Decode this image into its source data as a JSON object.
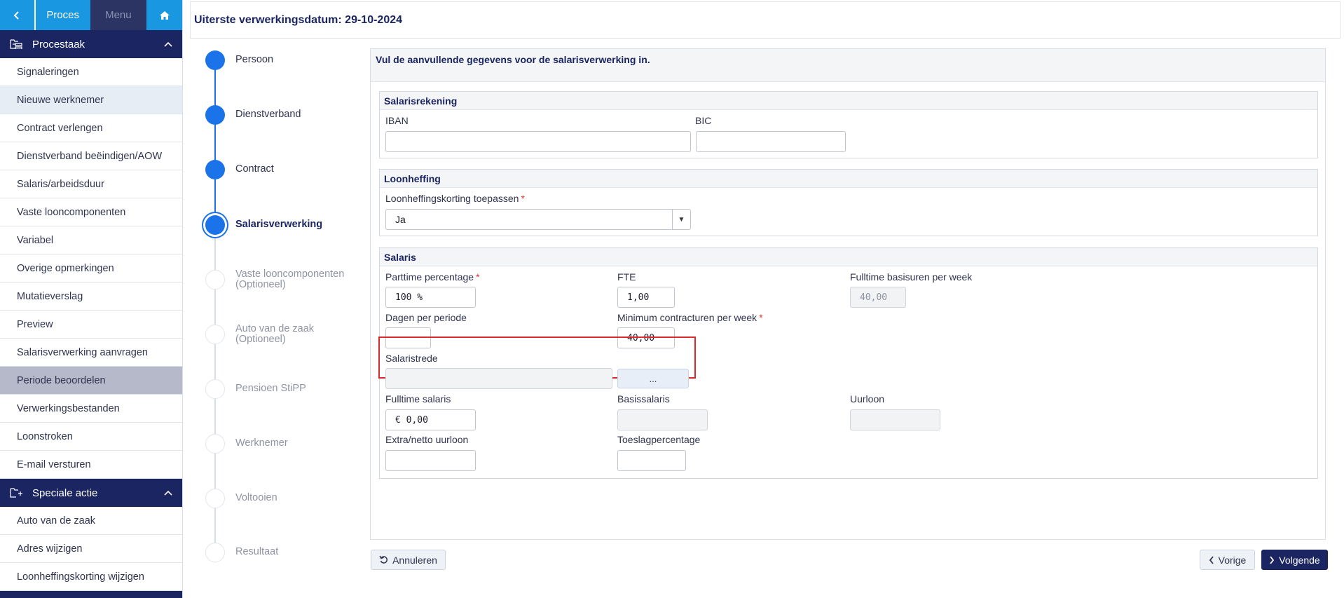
{
  "topbar": {
    "back_icon": "chevron-left-icon",
    "proces_label": "Proces",
    "menu_label": "Menu",
    "home_icon": "home-icon"
  },
  "sidebar": {
    "section1": {
      "label": "Procestaak",
      "icon": "folder-tree-icon"
    },
    "items1": [
      "Signaleringen",
      "Nieuwe werknemer",
      "Contract verlengen",
      "Dienstverband beëindigen/AOW",
      "Salaris/arbeidsduur",
      "Vaste looncomponenten",
      "Variabel",
      "Overige opmerkingen",
      "Mutatieverslag",
      "Preview",
      "Salarisverwerking aanvragen",
      "Periode beoordelen",
      "Verwerkingsbestanden",
      "Loonstroken",
      "E-mail versturen"
    ],
    "section2": {
      "label": "Speciale actie",
      "icon": "folder-plus-icon"
    },
    "items2": [
      "Auto van de zaak",
      "Adres wijzigen",
      "Loonheffingskorting wijzigen"
    ]
  },
  "header": {
    "title": "Uiterste verwerkingsdatum: 29-10-2024"
  },
  "steps": [
    {
      "label": "Persoon",
      "sub": ""
    },
    {
      "label": "Dienstverband",
      "sub": ""
    },
    {
      "label": "Contract",
      "sub": ""
    },
    {
      "label": "Salarisverwerking",
      "sub": ""
    },
    {
      "label": "Vaste looncomponenten",
      "sub": "(Optioneel)"
    },
    {
      "label": "Auto van de zaak",
      "sub": "(Optioneel)"
    },
    {
      "label": "Pensioen StiPP",
      "sub": ""
    },
    {
      "label": "Werknemer",
      "sub": ""
    },
    {
      "label": "Voltooien",
      "sub": ""
    },
    {
      "label": "Resultaat",
      "sub": ""
    }
  ],
  "form": {
    "intro": "Vul de aanvullende gegevens voor de salarisverwerking in.",
    "salarisrekening": {
      "legend": "Salarisrekening",
      "iban_label": "IBAN",
      "iban_value": "",
      "bic_label": "BIC",
      "bic_value": ""
    },
    "loonheffing": {
      "legend": "Loonheffing",
      "korting_label": "Loonheffingskorting toepassen",
      "korting_value": "Ja"
    },
    "salaris": {
      "legend": "Salaris",
      "parttime_label": "Parttime percentage",
      "parttime_value": "100 %",
      "fte_label": "FTE",
      "fte_value": "1,00",
      "fulltime_uren_label": "Fulltime basisuren per week",
      "fulltime_uren_value": "40,00",
      "dagen_label": "Dagen per periode",
      "dagen_value": "",
      "min_uren_label": "Minimum contracturen per week",
      "min_uren_value": "40,00",
      "trede_label": "Salaristrede",
      "trede_value": "",
      "trede_button": "...",
      "fulltime_salaris_label": "Fulltime salaris",
      "fulltime_salaris_value": "€ 0,00",
      "basis_label": "Basissalaris",
      "basis_value": "",
      "uurloon_label": "Uurloon",
      "uurloon_value": "",
      "extra_label": "Extra/netto uurloon",
      "extra_value": "",
      "toeslag_label": "Toeslagpercentage",
      "toeslag_value": ""
    }
  },
  "buttons": {
    "annuleren": "Annuleren",
    "annuleren_icon": "undo-icon",
    "vorige": "Vorige",
    "vorige_icon": "chevron-left-icon",
    "volgende": "Volgende",
    "volgende_icon": "chevron-right-icon"
  },
  "colors": {
    "navy": "#1b2561",
    "accent_blue": "#1997e0",
    "step_blue": "#1a73e8",
    "highlight_red": "#d92b2b"
  }
}
